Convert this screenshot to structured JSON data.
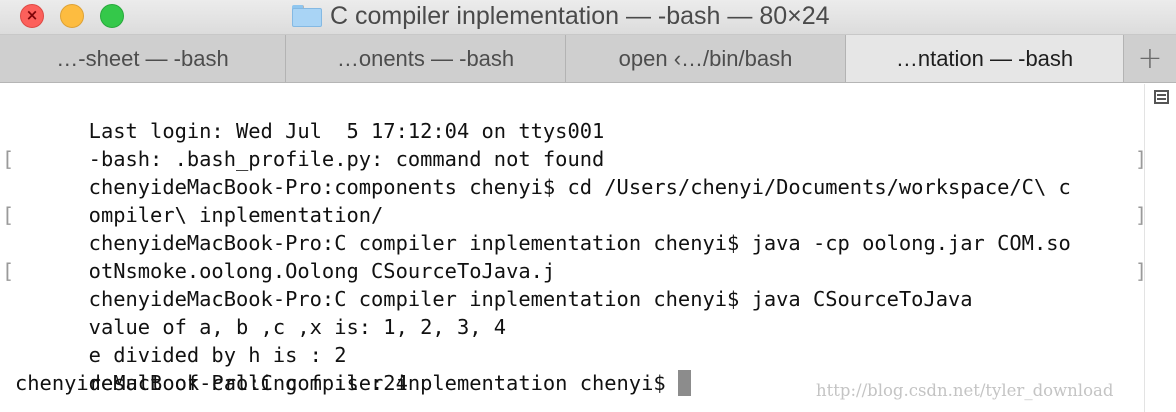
{
  "window": {
    "title": "C compiler inplementation — -bash — 80×24",
    "close_glyph": "×"
  },
  "tabs": [
    {
      "label": "…-sheet — -bash",
      "active": false
    },
    {
      "label": "…onents — -bash",
      "active": false
    },
    {
      "label": "open ‹…/bin/bash",
      "active": false
    },
    {
      "label": "…ntation — -bash",
      "active": true
    }
  ],
  "new_tab_label": "+",
  "terminal": {
    "lines": [
      {
        "text": "Last login: Wed Jul  5 17:12:04 on ttys001",
        "mark_left": "",
        "mark_right": ""
      },
      {
        "text": "-bash: .bash_profile.py: command not found",
        "mark_left": "",
        "mark_right": ""
      },
      {
        "text": "chenyideMacBook-Pro:components chenyi$ cd /Users/chenyi/Documents/workspace/C\\ c",
        "mark_left": "[",
        "mark_right": "]"
      },
      {
        "text": "ompiler\\ inplementation/",
        "mark_left": "",
        "mark_right": ""
      },
      {
        "text": "chenyideMacBook-Pro:C compiler inplementation chenyi$ java -cp oolong.jar COM.so",
        "mark_left": "[",
        "mark_right": "]"
      },
      {
        "text": "otNsmoke.oolong.Oolong CSourceToJava.j",
        "mark_left": "",
        "mark_right": ""
      },
      {
        "text": "chenyideMacBook-Pro:C compiler inplementation chenyi$ java CSourceToJava",
        "mark_left": "[",
        "mark_right": "]"
      },
      {
        "text": "value of a, b ,c ,x is: 1, 2, 3, 4",
        "mark_left": "",
        "mark_right": ""
      },
      {
        "text": "e divided by h is : 2",
        "mark_left": "",
        "mark_right": ""
      },
      {
        "text": "result of calling f is :24",
        "mark_left": "",
        "mark_right": ""
      }
    ],
    "prompt": "chenyideMacBook-Pro:C compiler inplementation chenyi$ "
  },
  "watermark": "http://blog.csdn.net/tyler_download",
  "icons": {
    "folder": "folder-icon",
    "scroll_marks": "scroll-marks-icon",
    "new_tab": "plus-icon"
  },
  "colors": {
    "close": "#fc605b",
    "minimize": "#fdbc40",
    "zoom": "#34c84a",
    "folder": "#a9d4f5",
    "cursor": "#8c8c8c"
  }
}
